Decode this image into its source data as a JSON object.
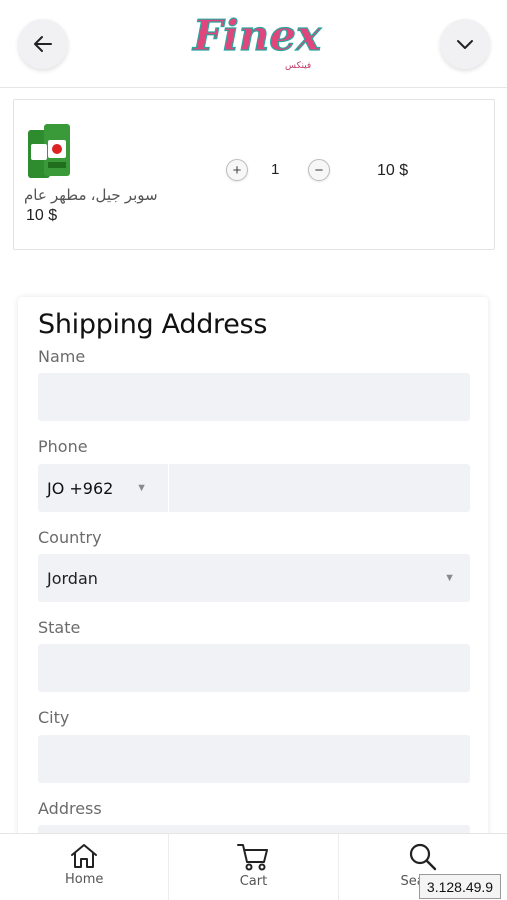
{
  "header": {
    "logo_text": "Finex",
    "logo_subtext": "فينكس"
  },
  "cart_item": {
    "name": "سوبر جيل، مطهر عام",
    "unit_price": "10 $",
    "quantity": "1",
    "plus_symbol": "+",
    "minus_symbol": "−",
    "line_total": "10 $"
  },
  "shipping": {
    "title": "Shipping Address",
    "name_label": "Name",
    "name_value": "",
    "phone_label": "Phone",
    "phone_code": "JO +962",
    "phone_value": "",
    "country_label": "Country",
    "country_value": "Jordan",
    "state_label": "State",
    "state_value": "",
    "city_label": "City",
    "city_value": "",
    "address_label": "Address",
    "address_value": ""
  },
  "bottom_nav": {
    "home": "Home",
    "cart": "Cart",
    "search": "Search"
  },
  "version": "3.128.49.9",
  "colors": {
    "field_bg": "#f0f2f5",
    "logo_pink": "#e0457b",
    "logo_teal": "#2aa6a0",
    "product_green": "#2e8b2e"
  },
  "icons": {
    "back": "arrow-left-icon",
    "menu": "chevron-down-icon",
    "home": "home-icon",
    "cart": "cart-icon",
    "search": "search-icon"
  }
}
